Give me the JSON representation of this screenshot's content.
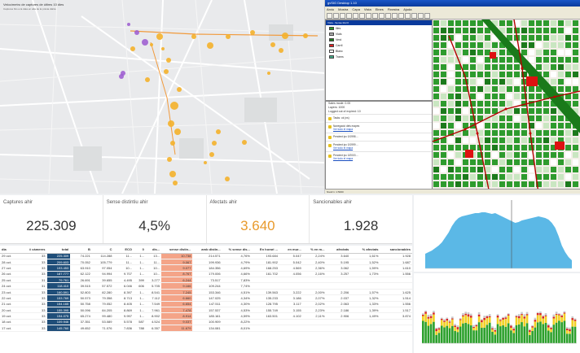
{
  "map": {
    "title": "Velocímetro de captures de últims 10 dies",
    "subtitle": "Captures fins a la data en alta de la prèvia diària",
    "points_orange": 30,
    "points_purple": 5,
    "colors": {
      "orange": "#f4b12b",
      "purple": "#9b59d0",
      "route": "#f19a3c"
    }
  },
  "gis": {
    "title": "gvSIG Desktop 1.10",
    "menus": [
      "Arxiu",
      "Mostra",
      "Capa",
      "Vista",
      "Eines",
      "Finestra",
      "Ajuda"
    ],
    "legend_title": "Vista - Sense títol 0",
    "legend_items": [
      {
        "label": "Illes",
        "color": "#2e9b2e"
      },
      {
        "label": "Vials",
        "color": "#aaaaaa"
      },
      {
        "label": "Verd",
        "color": "#1c7a1c"
      },
      {
        "label": "Carril",
        "color": "#d22"
      },
      {
        "label": "Blanc",
        "color": "#ffffff"
      },
      {
        "label": "Trams",
        "color": "#4a8"
      }
    ],
    "messages": [
      "Sales mode: 0.00",
      "Layers: 1000",
      "Logged out of expired: 10"
    ],
    "events": [
      {
        "text": "Tasks: ok (ns)",
        "link": ""
      },
      {
        "text": "Navegació dels mapes",
        "link": "Ver todo el mapa"
      },
      {
        "text": "Pendent ipc 0/1998 ...",
        "link": ""
      },
      {
        "text": "Pendent ipc 0/1999 ...",
        "link": "Ver todo el mapa"
      },
      {
        "text": "Pendent ipc 0/2003 ...",
        "link": "Ver todo el mapa"
      }
    ],
    "status": "Nivell 1: 1:5000"
  },
  "kpis": [
    {
      "label": "Captures ahir",
      "value": "225.309",
      "accent": false
    },
    {
      "label": "Sense distintiu ahir",
      "value": "4,5%",
      "accent": false
    },
    {
      "label": "Afectats ahir",
      "value": "3.640",
      "accent": true
    },
    {
      "label": "Sancionables ahir",
      "value": "1.928",
      "accent": false
    }
  ],
  "table": {
    "headers": [
      "dia",
      "# càmeres",
      "total",
      "B",
      "C",
      "ECO",
      "0",
      "dis...",
      "sense distin...",
      "amb distin...",
      "% sense dis...",
      "En horari ...",
      "en mur...",
      "% en m...",
      "afectats",
      "% afectats",
      "sancionables"
    ],
    "rows": [
      [
        "29 oct.",
        "33",
        "225.309",
        "74.221",
        "114.288",
        "11...",
        "1...",
        "13...",
        "10.738",
        "214.571",
        "4,76%",
        "193.684",
        "5.047",
        "2,24%",
        "3.640",
        "1,61%",
        "1.928"
      ],
      [
        "28 oct.",
        "33",
        "209.603",
        "70.052",
        "105.779",
        "11...",
        "1...",
        "11...",
        "9.067",
        "199.936",
        "4,79%",
        "181.902",
        "5.042",
        "2,40%",
        "5.195",
        "1,52%",
        "1.687"
      ],
      [
        "27 oct.",
        "33",
        "193.453",
        "63.910",
        "97.054",
        "10...",
        "1...",
        "10...",
        "9.077",
        "184.356",
        "4,69%",
        "168.253",
        "4.569",
        "2,36%",
        "3.062",
        "1,59%",
        "1.610"
      ],
      [
        "26 oct.",
        "33",
        "187.777",
        "62.122",
        "94.994",
        "9.707",
        "1...",
        "10...",
        "8.767",
        "179.006",
        "4,66%",
        "161.702",
        "4.056",
        "2,16%",
        "3.257",
        "1,73%",
        "1.556"
      ],
      [
        "25 oct.",
        "31",
        "79.761",
        "26.691",
        "39.655",
        "4.495",
        "399",
        "3.277",
        "6.244",
        "73.517",
        "7,83%",
        "",
        "",
        "",
        "",
        "",
        ""
      ],
      [
        "24 oct.",
        "31",
        "118.410",
        "39.515",
        "57.572",
        "6.046",
        "606",
        "5.705",
        "9.166",
        "109.244",
        "7,74%",
        "",
        "",
        "",
        "",
        "",
        ""
      ],
      [
        "23 oct.",
        "33",
        "160.591",
        "52.803",
        "82.280",
        "8.397",
        "1...",
        "8.541",
        "7.245",
        "153.346",
        "4,51%",
        "139.563",
        "3.222",
        "2,00%",
        "2.206",
        "1,57%",
        "1.625"
      ],
      [
        "22 oct.",
        "33",
        "153.769",
        "50.573",
        "79.358",
        "8.713",
        "1...",
        "7.112",
        "6.660",
        "147.025",
        "4,34%",
        "135.233",
        "3.186",
        "2,07%",
        "2.037",
        "1,32%",
        "1.514"
      ],
      [
        "21 oct.",
        "33",
        "154.165",
        "50.758",
        "79.052",
        "8.405",
        "1...",
        "7.549",
        "6.654",
        "147.511",
        "4,30%",
        "128.795",
        "3.117",
        "2,02%",
        "2.063",
        "1,33%",
        "1.556"
      ],
      [
        "20 oct.",
        "33",
        "155.395",
        "50.096",
        "84.205",
        "8.869",
        "1...",
        "7.961",
        "7.478",
        "157.537",
        "4,53%",
        "155.749",
        "3.155",
        "2,23%",
        "2.186",
        "1,39%",
        "1.517"
      ],
      [
        "19 oct.",
        "33",
        "194.075",
        "65.274",
        "99.480",
        "9.997",
        "1...",
        "8.902",
        "8.914",
        "185.161",
        "4,59%",
        "163.501",
        "4.102",
        "2,11%",
        "2.906",
        "1,49%",
        "3.874"
      ],
      [
        "18 oct.",
        "33",
        "109.946",
        "37.351",
        "53.089",
        "5.578",
        "587",
        "4.524",
        "9.037",
        "100.909",
        "8,22%",
        "",
        "",
        "",
        "",
        "",
        ""
      ],
      [
        "17 oct.",
        "33",
        "145.760",
        "49.652",
        "71.076",
        "7.836",
        "788",
        "6.357",
        "11.679",
        "134.081",
        "8,01%",
        "",
        "",
        "",
        "",
        "",
        ""
      ]
    ]
  },
  "area_chart": {
    "color": "#5bb8e6",
    "marker_color": "#555555"
  },
  "bar_chart": {
    "colors": {
      "green": "#2ca02c",
      "yellow": "#f2d024",
      "red": "#d62728",
      "grey": "#c9c9c9"
    }
  }
}
